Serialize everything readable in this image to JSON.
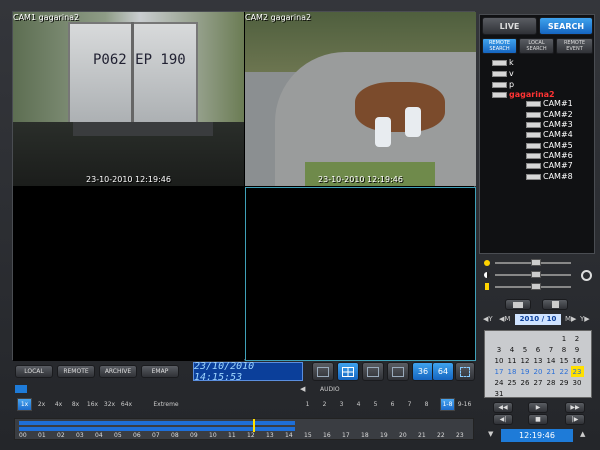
{
  "cameras": [
    {
      "title": "CAM1  gagarina2",
      "timestamp": "23-10-2010 12:19:46"
    },
    {
      "title": "CAM2  gagarina2",
      "timestamp": "23-10-2010 12:19:46"
    }
  ],
  "truck_plate": "P062 EP 190",
  "tabs": {
    "live": "LIVE",
    "search": "SEARCH"
  },
  "subtabs": {
    "remote": "REMOTE SEARCH",
    "local": "LOCAL SEARCH",
    "event": "REMOTE EVENT"
  },
  "tree": {
    "sites": [
      "k",
      "v",
      "p"
    ],
    "group": "gagarina2",
    "cams": [
      "CAM#1",
      "CAM#2",
      "CAM#3",
      "CAM#4",
      "CAM#5",
      "CAM#6",
      "CAM#7",
      "CAM#8"
    ]
  },
  "bottom_buttons": {
    "local": "LOCAL",
    "remote": "REMOTE",
    "archive": "ARCHIVE",
    "emap": "EMAP"
  },
  "datetime_display": "23/10/2010 14:15:53",
  "layout_buttons": [
    "36",
    "64"
  ],
  "audio_label": "AUDIO",
  "speeds": [
    "1x",
    "2x",
    "4x",
    "8x",
    "16x",
    "32x",
    "64x",
    "Extreme"
  ],
  "audio_channels": [
    "1",
    "2",
    "3",
    "4",
    "5",
    "6",
    "7",
    "8"
  ],
  "channel_groups": [
    "1-8",
    "9-16"
  ],
  "timeline_hours": [
    "00",
    "01",
    "02",
    "03",
    "04",
    "05",
    "06",
    "07",
    "08",
    "09",
    "10",
    "11",
    "12",
    "13",
    "14",
    "15",
    "16",
    "17",
    "18",
    "19",
    "20",
    "21",
    "22",
    "23"
  ],
  "calendar": {
    "month": "2010 / 10",
    "rows": [
      [
        "",
        "",
        "",
        "",
        "",
        "1",
        "2"
      ],
      [
        "3",
        "4",
        "5",
        "6",
        "7",
        "8",
        "9"
      ],
      [
        "10",
        "11",
        "12",
        "13",
        "14",
        "15",
        "16"
      ],
      [
        "17",
        "18",
        "19",
        "20",
        "21",
        "22",
        "23"
      ],
      [
        "24",
        "25",
        "26",
        "27",
        "28",
        "29",
        "30"
      ],
      [
        "31",
        "",
        "",
        "",
        "",
        "",
        ""
      ]
    ]
  },
  "playback_time": "12:19:46"
}
